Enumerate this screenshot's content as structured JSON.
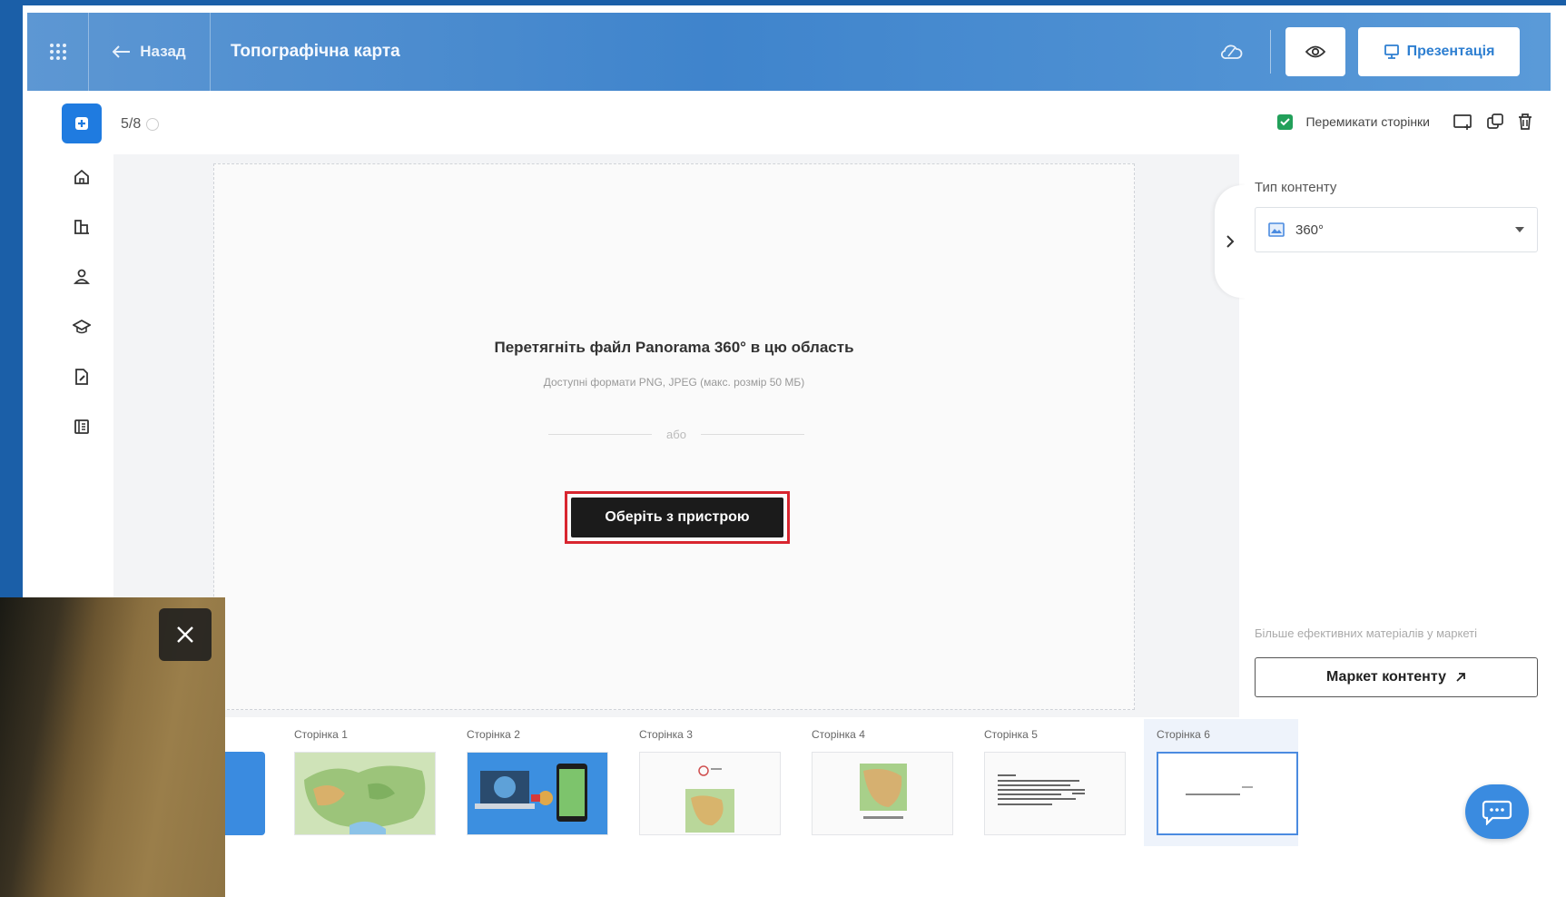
{
  "header": {
    "back_label": "Назад",
    "title": "Топографічна карта",
    "present_label": "Презентація"
  },
  "toolbar": {
    "page_counter": "5/8",
    "switch_pages_label": "Перемикати сторінки"
  },
  "dropzone": {
    "title": "Перетягніть файл Panorama 360° в цю область",
    "subtitle": "Доступні формати PNG, JPEG (макс. розмір 50 МБ)",
    "or_label": "або",
    "choose_button": "Оберіть з пристрою"
  },
  "right_panel": {
    "content_type_label": "Тип контенту",
    "content_type_value": "360°",
    "more_materials": "Більше ефективних матеріалів у маркеті",
    "market_button": "Маркет контенту"
  },
  "thumbnails": [
    {
      "label": "Сторінка 1",
      "kind": "map"
    },
    {
      "label": "Сторінка 2",
      "kind": "laptop-phone"
    },
    {
      "label": "Сторінка 3",
      "kind": "small-map"
    },
    {
      "label": "Сторінка 4",
      "kind": "map-small"
    },
    {
      "label": "Сторінка 5",
      "kind": "text"
    },
    {
      "label": "Сторінка 6",
      "kind": "blank-active"
    }
  ],
  "colors": {
    "accent": "#1f7be0",
    "header_gradient_start": "#5d97d3",
    "highlight_border": "#d8252f",
    "checkbox": "#22a05a"
  }
}
